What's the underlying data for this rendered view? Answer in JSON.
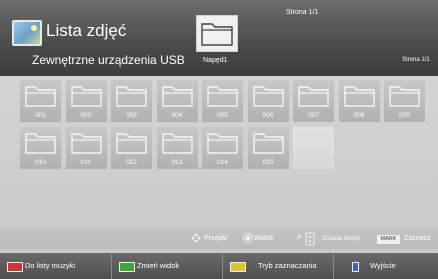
{
  "header": {
    "title": "Lista zdjęć",
    "source": "Zewnętrzne urządzenia USB",
    "drive_label": "Napęd1",
    "page_top": "Strona 1/1",
    "page_right": "Strona 1/1"
  },
  "folders": [
    "001",
    "002",
    "003",
    "004",
    "005",
    "006",
    "007",
    "008",
    "009",
    "010",
    "011",
    "012",
    "013",
    "014",
    "015"
  ],
  "hints": {
    "navigate": "Przejdź",
    "view": "Widok",
    "page_key": "P",
    "page_change": "Zmiana strony",
    "mark_key": "MARK",
    "mark_label": "Zaznacz"
  },
  "buttons": [
    {
      "label": "Do listy muzyki",
      "color": "#c23b3b"
    },
    {
      "label": "Zmień widok",
      "color": "#3fa33f"
    },
    {
      "label": "Tryb zaznaczania",
      "color": "#d8c43a"
    },
    {
      "label": "Wyjście",
      "color": "#3b5fc2"
    }
  ]
}
